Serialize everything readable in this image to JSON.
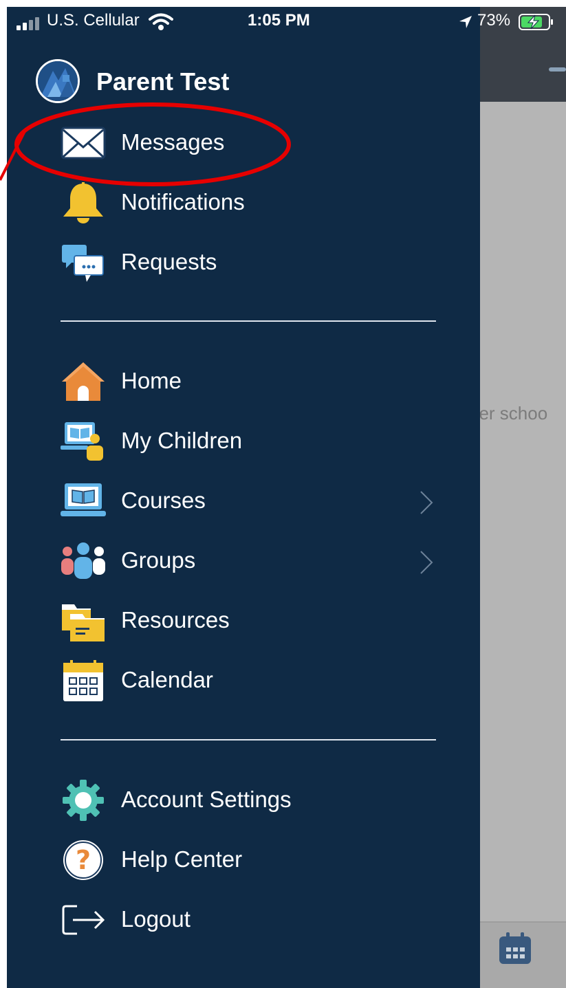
{
  "status_bar": {
    "carrier": "U.S. Cellular",
    "time": "1:05 PM",
    "battery_percent": "73%"
  },
  "background": {
    "body_text": "her schoo",
    "calendar_icon": "calendar-icon"
  },
  "drawer": {
    "profile": {
      "name": "Parent Test",
      "avatar_icon": "profile-avatar"
    },
    "group1": [
      {
        "id": "messages",
        "label": "Messages",
        "icon": "envelope-icon"
      },
      {
        "id": "notifications",
        "label": "Notifications",
        "icon": "bell-icon"
      },
      {
        "id": "requests",
        "label": "Requests",
        "icon": "chat-bubbles-icon"
      }
    ],
    "group2": [
      {
        "id": "home",
        "label": "Home",
        "icon": "house-icon"
      },
      {
        "id": "my-children",
        "label": "My Children",
        "icon": "children-icon"
      },
      {
        "id": "courses",
        "label": "Courses",
        "icon": "laptop-book-icon",
        "has_submenu": true
      },
      {
        "id": "groups",
        "label": "Groups",
        "icon": "people-group-icon",
        "has_submenu": true
      },
      {
        "id": "resources",
        "label": "Resources",
        "icon": "folders-icon"
      },
      {
        "id": "calendar",
        "label": "Calendar",
        "icon": "calendar-icon"
      }
    ],
    "group3": [
      {
        "id": "account-settings",
        "label": "Account Settings",
        "icon": "gear-icon"
      },
      {
        "id": "help-center",
        "label": "Help Center",
        "icon": "question-icon"
      },
      {
        "id": "logout",
        "label": "Logout",
        "icon": "logout-icon"
      }
    ]
  },
  "colors": {
    "drawer_bg": "#0f2a45",
    "annotation": "#e60000",
    "battery_fill": "#4cd964"
  }
}
